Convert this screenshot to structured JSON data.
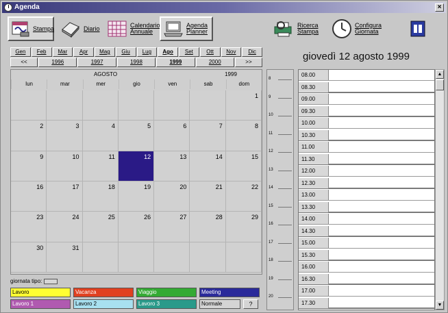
{
  "window": {
    "title": "Agenda",
    "close_label": "×"
  },
  "toolbar": {
    "items": [
      {
        "label": "Stampa",
        "icon": "printer-calendar-icon"
      },
      {
        "label": "Diario",
        "icon": "diary-icon"
      },
      {
        "label": "Calendario\nAnnuale",
        "icon": "grid-calendar-icon"
      },
      {
        "label": "Agenda\nPlanner",
        "icon": "planner-icon"
      },
      {
        "label": "Ricerca\nStampa",
        "icon": "search-print-icon"
      },
      {
        "label": "Configura\nGiornata",
        "icon": "clock-icon"
      },
      {
        "label": "",
        "icon": "calendar-page-icon"
      }
    ]
  },
  "months": [
    {
      "label": "Gen"
    },
    {
      "label": "Feb"
    },
    {
      "label": "Mar"
    },
    {
      "label": "Apr"
    },
    {
      "label": "Mag"
    },
    {
      "label": "Giu"
    },
    {
      "label": "Lug"
    },
    {
      "label": "Ago"
    },
    {
      "label": "Set"
    },
    {
      "label": "Ott"
    },
    {
      "label": "Nov"
    },
    {
      "label": "Dic"
    }
  ],
  "selected_month_index": 7,
  "years": [
    {
      "label": "<<"
    },
    {
      "label": "1996"
    },
    {
      "label": "1997"
    },
    {
      "label": "1998"
    },
    {
      "label": "1999"
    },
    {
      "label": "2000"
    },
    {
      "label": ">>"
    }
  ],
  "selected_year_index": 4,
  "calendar": {
    "month_name": "AGOSTO",
    "year": "1999",
    "weekdays": [
      "lun",
      "mar",
      "mer",
      "gio",
      "ven",
      "sab",
      "dom"
    ],
    "weeks": [
      [
        "",
        "",
        "",
        "",
        "",
        "",
        "1"
      ],
      [
        "2",
        "3",
        "4",
        "5",
        "6",
        "7",
        "8"
      ],
      [
        "9",
        "10",
        "11",
        "12",
        "13",
        "14",
        "15"
      ],
      [
        "16",
        "17",
        "18",
        "19",
        "20",
        "21",
        "22"
      ],
      [
        "23",
        "24",
        "25",
        "26",
        "27",
        "28",
        "29"
      ],
      [
        "30",
        "31",
        "",
        "",
        "",
        "",
        ""
      ]
    ],
    "today": "12"
  },
  "legend": {
    "label": "giornata tipo:",
    "swatches": [
      {
        "label": "Lavoro",
        "color": "#ffff33",
        "text": "#000000"
      },
      {
        "label": "Vacanza",
        "color": "#e04020",
        "text": "#ffffff"
      },
      {
        "label": "Viaggio",
        "color": "#33aa33",
        "text": "#ffffff"
      },
      {
        "label": "Meeting",
        "color": "#2a2a9a",
        "text": "#ffffff"
      },
      {
        "label": "Lavoro 1",
        "color": "#b05ab0",
        "text": "#ffffff"
      },
      {
        "label": "Lavoro 2",
        "color": "#a8e0f0",
        "text": "#000000"
      },
      {
        "label": "Lavoro 3",
        "color": "#2a9a8a",
        "text": "#ffffff"
      },
      {
        "label": "Normale",
        "color": "#d4d4d4",
        "text": "#000000"
      }
    ],
    "help_label": "?"
  },
  "day": {
    "header": "giovedì 12 agosto 1999",
    "slots": [
      "08.00",
      "08.30",
      "09.00",
      "09.30",
      "10.00",
      "10.30",
      "11.00",
      "11.30",
      "12.00",
      "12.30",
      "13.00",
      "13.30",
      "14.00",
      "14.30",
      "15.00",
      "15.30",
      "16.00",
      "16.30",
      "17.00",
      "17.30"
    ],
    "ruler_ticks": [
      "8",
      "9",
      "10",
      "11",
      "12",
      "13",
      "14",
      "15",
      "16",
      "17",
      "18",
      "19",
      "20"
    ]
  },
  "colors": {
    "today_bg": "#2a1a86"
  }
}
